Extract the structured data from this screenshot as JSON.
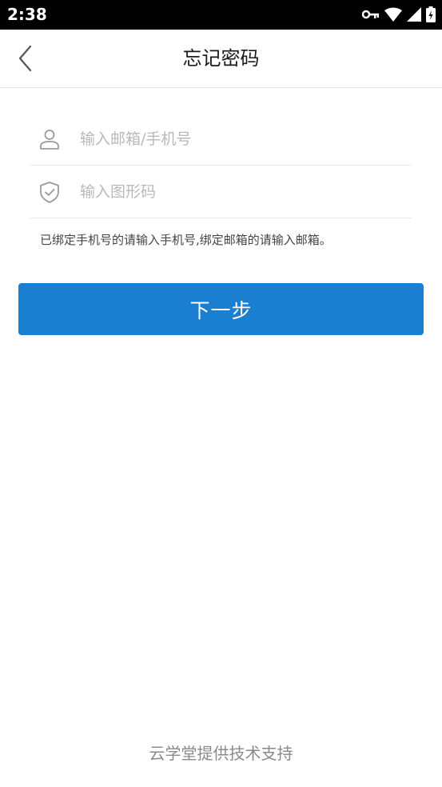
{
  "status_bar": {
    "time": "2:38",
    "icons": [
      "key-icon",
      "wifi-icon",
      "signal-icon",
      "battery-icon"
    ]
  },
  "header": {
    "title": "忘记密码",
    "back_icon": "chevron-left-icon"
  },
  "form": {
    "account": {
      "placeholder": "输入邮箱/手机号",
      "value": "",
      "icon": "user-icon"
    },
    "captcha": {
      "placeholder": "输入图形码",
      "value": "",
      "icon": "shield-check-icon"
    },
    "hint": "已绑定手机号的请输入手机号,绑定邮箱的请输入邮箱。",
    "next_label": "下一步"
  },
  "footer": {
    "text": "云学堂提供技术支持"
  },
  "colors": {
    "primary": "#1a7fd0",
    "status_bar": "#000000",
    "placeholder": "#b9b9b9",
    "icon_gray": "#9a9a9a"
  }
}
